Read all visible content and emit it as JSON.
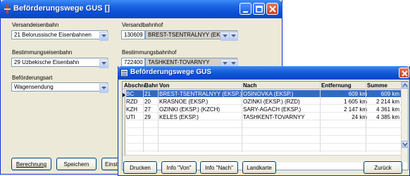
{
  "main_window": {
    "title": "Beförderungswege GUS []",
    "versandeisenbahn": {
      "label": "Versandeisenbahn",
      "value": "21 Belorussische Eisenbahnen"
    },
    "versandbahnhof": {
      "label": "Versandbahnhof",
      "code": "130609",
      "name": "BREST-TSENTRALNYY (EKSP.)"
    },
    "bestimmungseisenbahn": {
      "label": "Bestimmungseisenbahn",
      "value": "29 Uzbekische Eisenbahn"
    },
    "bestimmungsbahnhof": {
      "label": "Bestimmungsbahnhof",
      "code": "722400",
      "name": "TASHKENT-TOVARNYY"
    },
    "befoerderungsart": {
      "label": "Beförderungsart",
      "value": "Wagensendung"
    },
    "buttons": {
      "berechnung": "Berechnung",
      "speichern": "Speichern",
      "einstellungen": "Einste"
    }
  },
  "route_window": {
    "title": "Beförderungswege GUS",
    "columns": {
      "abschn": "Abschn",
      "bahn": "Bahn",
      "von": "Von",
      "nach": "Nach",
      "entfernung": "Entfernung",
      "summe": "Summe"
    },
    "rows": [
      {
        "abschn": "BC",
        "bahn": "21",
        "von": "BREST-TSENTRALNYY (EKSP.)",
        "nach": "OSINOVKA (EKSP.)",
        "entfernung": "609 km",
        "summe": "609 km"
      },
      {
        "abschn": "RZD",
        "bahn": "20",
        "von": "KRASNOE (EKSP.)",
        "nach": "OZINKI (EKSP.) (RZD)",
        "entfernung": "1 605 km",
        "summe": "2 214 km"
      },
      {
        "abschn": "KZH",
        "bahn": "27",
        "von": "OZINKI (EKSP.) (KZCH)",
        "nach": "SARY-AGACH (EKSP.)",
        "entfernung": "2 147 km",
        "summe": "4 361 km"
      },
      {
        "abschn": "UTI",
        "bahn": "29",
        "von": "KELES (EKSP.)",
        "nach": "TASHKENT-TOVARNYY",
        "entfernung": "24 km",
        "summe": "4 385 km"
      }
    ],
    "buttons": {
      "drucken": "Drucken",
      "info_von": "Info \"Von\"",
      "info_nach": "Info \"Nach\"",
      "landkarte": "Landkarte",
      "zurueck": "Zurück"
    }
  },
  "colors": {
    "titlebar": "#0a4fd6",
    "selection": "#316ac5",
    "window_bg": "#ece9d8"
  }
}
